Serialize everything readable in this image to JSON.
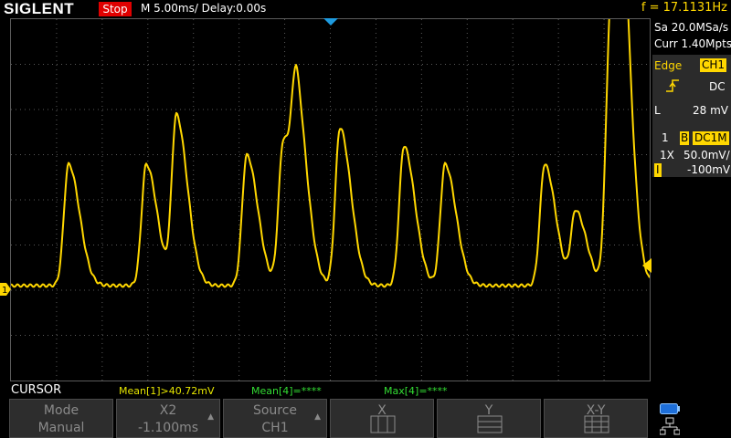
{
  "header": {
    "brand": "SIGLENT",
    "run_state": "Stop",
    "timebase": "M 5.00ms/ Delay:0.00s",
    "frequency": "f = 17.1131Hz"
  },
  "side_panel": {
    "sample_rate": "Sa 20.0MSa/s",
    "memory_depth": "Curr 1.40Mpts",
    "trigger_type": "Edge",
    "trigger_source": "CH1",
    "trigger_coupling": "DC",
    "trigger_level_label": "L",
    "trigger_level": "28 mV",
    "channel_number": "1",
    "bandwidth_limit": "B",
    "channel_coupling": "DC1M",
    "probe": "1X",
    "volts_per_div": "50.0mV/",
    "offset_marker": "I",
    "offset": "-100mV"
  },
  "markers": {
    "channel1": "1"
  },
  "cursor_bar": {
    "title": "CURSOR",
    "mean1": "Mean[1]>40.72mV",
    "mean4": "Mean[4]=****",
    "max4": "Max[4]=****"
  },
  "softkeys": [
    {
      "line1": "Mode",
      "line2": "Manual"
    },
    {
      "line1": "X2",
      "line2": "-1.100ms"
    },
    {
      "line1": "Source",
      "line2": "CH1"
    },
    {
      "line1": "X",
      "line2": ""
    },
    {
      "line1": "Y",
      "line2": ""
    },
    {
      "line1": "X-Y",
      "line2": ""
    }
  ],
  "colors": {
    "trace": "#ffd700",
    "grid": "#5a5a5a",
    "stop": "#e00000",
    "trigger_marker": "#1e9be0",
    "measure_cursor": "#e6e600",
    "measure_green": "#33dd33"
  },
  "icons": {
    "trigger_edge": "rising-edge-icon",
    "network": "network-icon",
    "battery": "status-icon"
  }
}
